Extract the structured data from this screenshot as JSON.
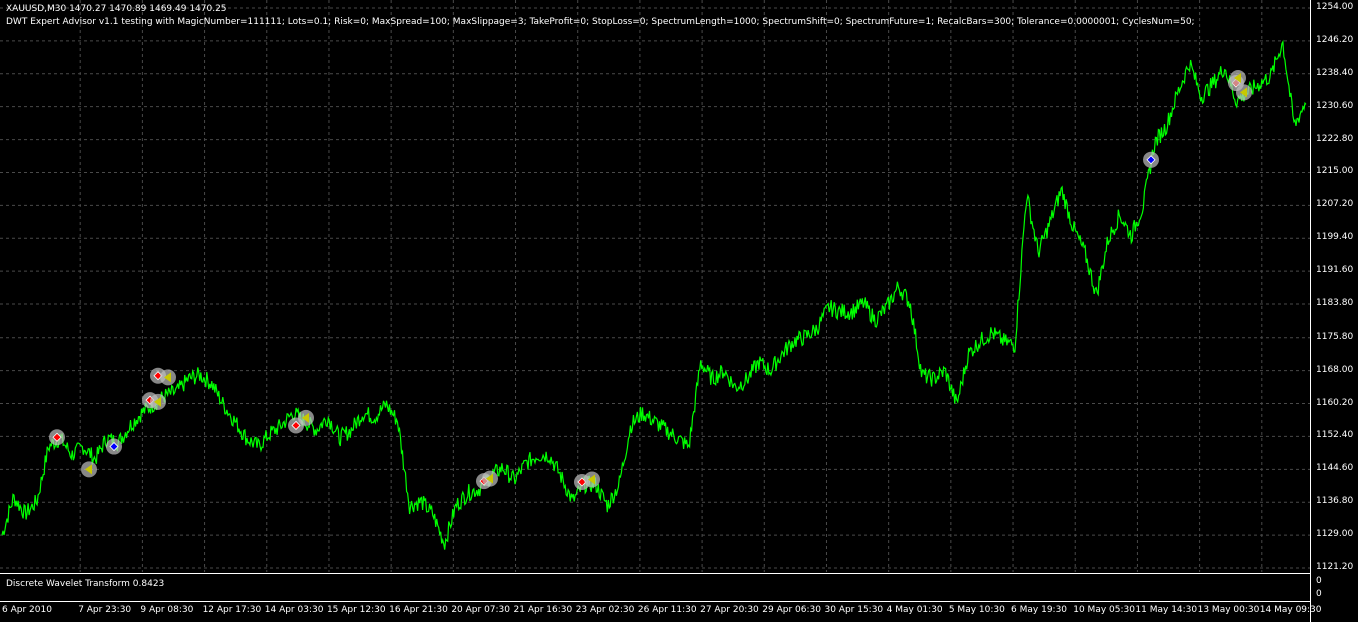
{
  "header": {
    "symbol_line": "XAUUSD,M30  1470.27 1470.89 1469.49 1470.25",
    "ea_line": "DWT Expert Advisor v1.1 testing with MagicNumber=111111; Lots=0.1; Risk=0; MaxSpread=100; MaxSlippage=3; TakeProfit=0; StopLoss=0; SpectrumLength=1000; SpectrumShift=0; SpectrumFuture=1; RecalcBars=300; Tolerance=0.0000001; CyclesNum=50;"
  },
  "indicator": {
    "label": "Discrete Wavelet Transform 0.8423",
    "scale_top": "0",
    "scale_bottom": "0"
  },
  "price_axis": [
    "1254.00",
    "1246.20",
    "1238.40",
    "1230.60",
    "1222.80",
    "1215.00",
    "1207.20",
    "1199.40",
    "1191.60",
    "1183.80",
    "1175.80",
    "1168.00",
    "1160.20",
    "1152.40",
    "1144.60",
    "1136.80",
    "1129.00",
    "1121.20"
  ],
  "time_axis": [
    "6 Apr 2010",
    "7 Apr 23:30",
    "9 Apr 08:30",
    "12 Apr 17:30",
    "14 Apr 03:30",
    "15 Apr 12:30",
    "16 Apr 21:30",
    "20 Apr 07:30",
    "21 Apr 16:30",
    "23 Apr 02:30",
    "26 Apr 11:30",
    "27 Apr 20:30",
    "29 Apr 06:30",
    "30 Apr 15:30",
    "4 May 01:30",
    "5 May 10:30",
    "6 May 19:30",
    "10 May 05:30",
    "11 May 14:30",
    "13 May 00:30",
    "14 May 09:30"
  ],
  "colors": {
    "background": "#000000",
    "price_line": "#00ff00",
    "grid": "#4a4a4a",
    "axis": "#ffffff",
    "buy_marker": "#ff0000",
    "sell_marker": "#0000ff",
    "marker_ring": "#c0c0c0"
  },
  "chart_data": {
    "type": "line",
    "title": "XAUUSD,M30",
    "ylim": [
      1121.2,
      1254.0
    ],
    "x": [
      0,
      5,
      10,
      15,
      20,
      25,
      30,
      35,
      40,
      45,
      50,
      55,
      60,
      65,
      70,
      75,
      80,
      85,
      90,
      95,
      100
    ],
    "series": [
      {
        "values": [
          1129,
          1138,
          1134,
          1137,
          1150,
          1152,
          1148,
          1150,
          1147,
          1152,
          1151,
          1155,
          1158,
          1160,
          1162,
          1163,
          1166,
          1167,
          1165,
          1160,
          1156,
          1152,
          1150,
          1153,
          1155,
          1158,
          1156,
          1154,
          1157,
          1152,
          1154,
          1158,
          1157,
          1160,
          1156,
          1136,
          1137,
          1134,
          1127,
          1136,
          1139,
          1140,
          1143,
          1145,
          1142,
          1146,
          1148,
          1148,
          1143,
          1137,
          1141,
          1141,
          1136,
          1141,
          1155,
          1158,
          1156,
          1154,
          1152,
          1150,
          1170,
          1166,
          1168,
          1164,
          1166,
          1170,
          1168,
          1172,
          1175,
          1176,
          1178,
          1183,
          1182,
          1182,
          1184,
          1180,
          1183,
          1188,
          1184,
          1167,
          1166,
          1168,
          1160,
          1172,
          1175,
          1177,
          1175,
          1174,
          1210,
          1196,
          1203,
          1211,
          1202,
          1196,
          1186,
          1199,
          1205,
          1200,
          1207,
          1222,
          1226,
          1234,
          1241,
          1233,
          1236,
          1240,
          1232,
          1234,
          1236,
          1238,
          1246,
          1226,
          1232
        ]
      }
    ],
    "trade_markers": [
      {
        "price": 1152.2,
        "kind": "buy"
      },
      {
        "price": 1144.6,
        "kind": "close"
      },
      {
        "price": 1150.0,
        "kind": "sell"
      },
      {
        "price": 1161.0,
        "kind": "buy"
      },
      {
        "price": 1160.6,
        "kind": "close"
      },
      {
        "price": 1166.8,
        "kind": "buy"
      },
      {
        "price": 1166.4,
        "kind": "close"
      },
      {
        "price": 1155.0,
        "kind": "buy"
      },
      {
        "price": 1156.8,
        "kind": "close"
      },
      {
        "price": 1141.8,
        "kind": "buy"
      },
      {
        "price": 1142.4,
        "kind": "close"
      },
      {
        "price": 1141.6,
        "kind": "buy"
      },
      {
        "price": 1142.2,
        "kind": "close"
      },
      {
        "price": 1218.0,
        "kind": "sell"
      },
      {
        "price": 1236.2,
        "kind": "buy"
      },
      {
        "price": 1237.4,
        "kind": "close"
      },
      {
        "price": 1234.0,
        "kind": "close"
      }
    ]
  }
}
